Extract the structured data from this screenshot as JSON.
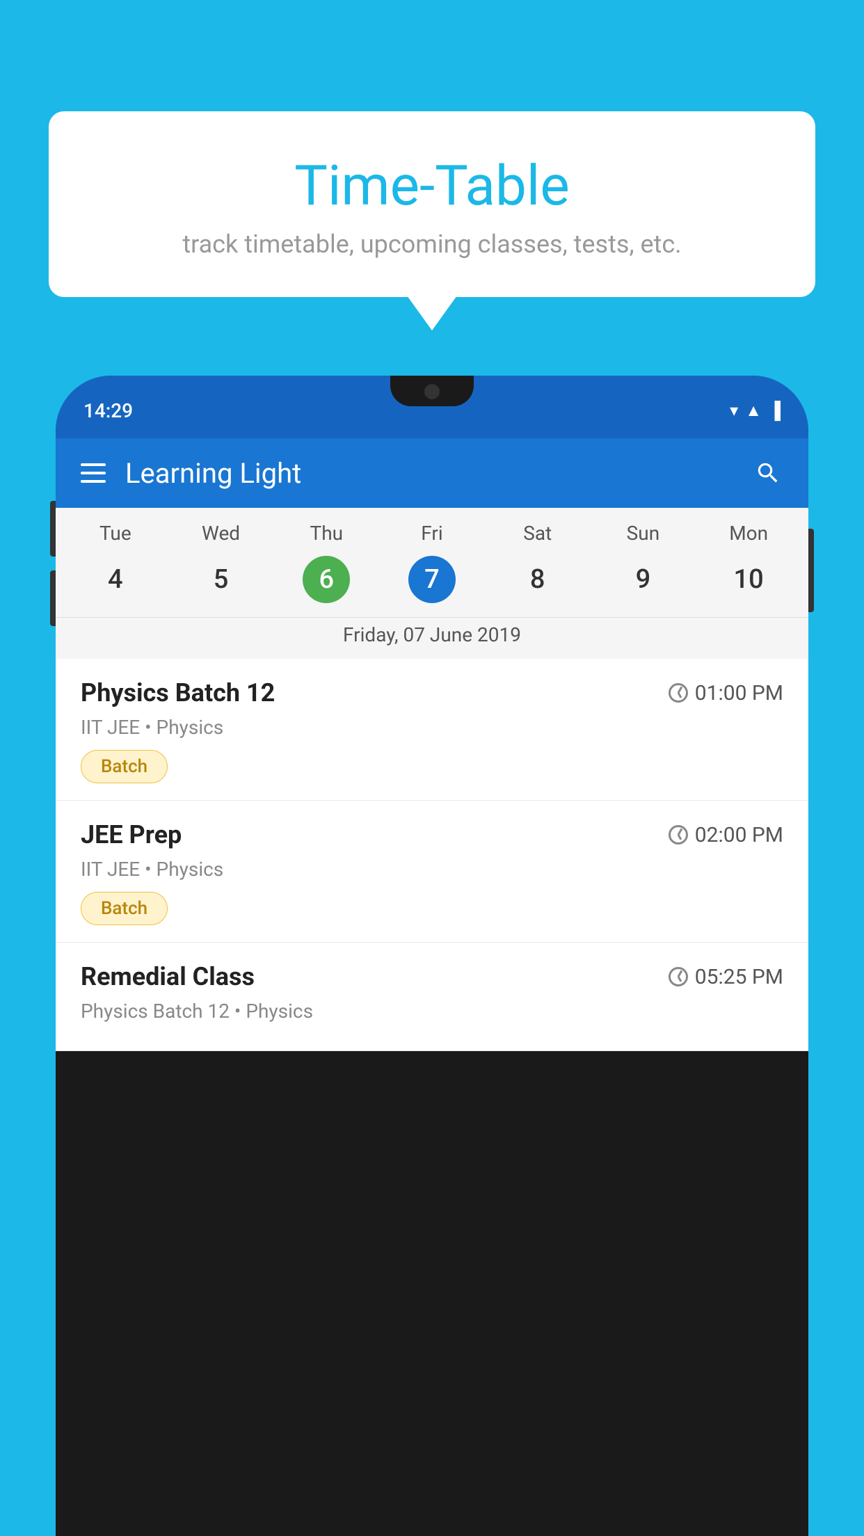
{
  "page": {
    "background_color": "#1BB8E8"
  },
  "speech_bubble": {
    "title": "Time-Table",
    "subtitle": "track timetable, upcoming classes, tests, etc."
  },
  "phone": {
    "status_bar": {
      "time": "14:29"
    },
    "toolbar": {
      "title": "Learning Light"
    },
    "calendar": {
      "days_of_week": [
        "Tue",
        "Wed",
        "Thu",
        "Fri",
        "Sat",
        "Sun",
        "Mon"
      ],
      "dates": [
        "4",
        "5",
        "6",
        "7",
        "8",
        "9",
        "10"
      ],
      "today_index": 2,
      "selected_index": 3,
      "selected_date_label": "Friday, 07 June 2019"
    },
    "classes": [
      {
        "name": "Physics Batch 12",
        "time": "01:00 PM",
        "meta": "IIT JEE • Physics",
        "badge": "Batch"
      },
      {
        "name": "JEE Prep",
        "time": "02:00 PM",
        "meta": "IIT JEE • Physics",
        "badge": "Batch"
      },
      {
        "name": "Remedial Class",
        "time": "05:25 PM",
        "meta": "Physics Batch 12 • Physics",
        "badge": null
      }
    ]
  }
}
